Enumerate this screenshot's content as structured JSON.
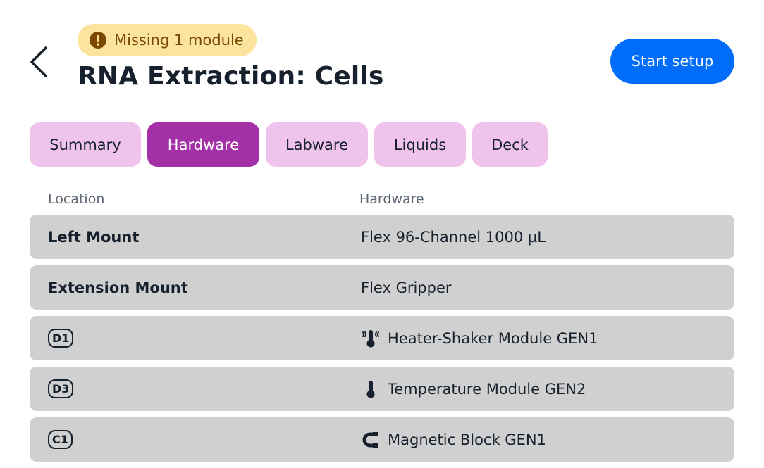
{
  "header": {
    "back_icon": "chevron-left-icon",
    "badge": {
      "icon": "alert-circle-icon",
      "text": "Missing 1 module"
    },
    "title": "RNA Extraction: Cells",
    "start_button": "Start setup"
  },
  "tabs": [
    {
      "label": "Summary",
      "active": false
    },
    {
      "label": "Hardware",
      "active": true
    },
    {
      "label": "Labware",
      "active": false
    },
    {
      "label": "Liquids",
      "active": false
    },
    {
      "label": "Deck",
      "active": false
    }
  ],
  "table": {
    "columns": [
      "Location",
      "Hardware"
    ],
    "rows": [
      {
        "location": "Left Mount",
        "hardware": "Flex 96-Channel 1000 µL"
      },
      {
        "location": "Extension Mount",
        "hardware": "Flex Gripper"
      },
      {
        "location": "D1",
        "hardware": "Heater-Shaker Module GEN1",
        "icon": "heater-shaker-icon"
      },
      {
        "location": "D3",
        "hardware": "Temperature Module GEN2",
        "icon": "thermometer-icon"
      },
      {
        "location": "C1",
        "hardware": "Magnetic Block GEN1",
        "icon": "magnet-icon"
      }
    ]
  },
  "colors": {
    "primary_blue": "#006cfa",
    "active_tab": "#a330a6",
    "inactive_tab": "#efc3ec",
    "warning_bg": "#fde49e",
    "warning_text": "#7a4a00",
    "row_bg": "#d0d0d0",
    "text": "#16212d"
  }
}
